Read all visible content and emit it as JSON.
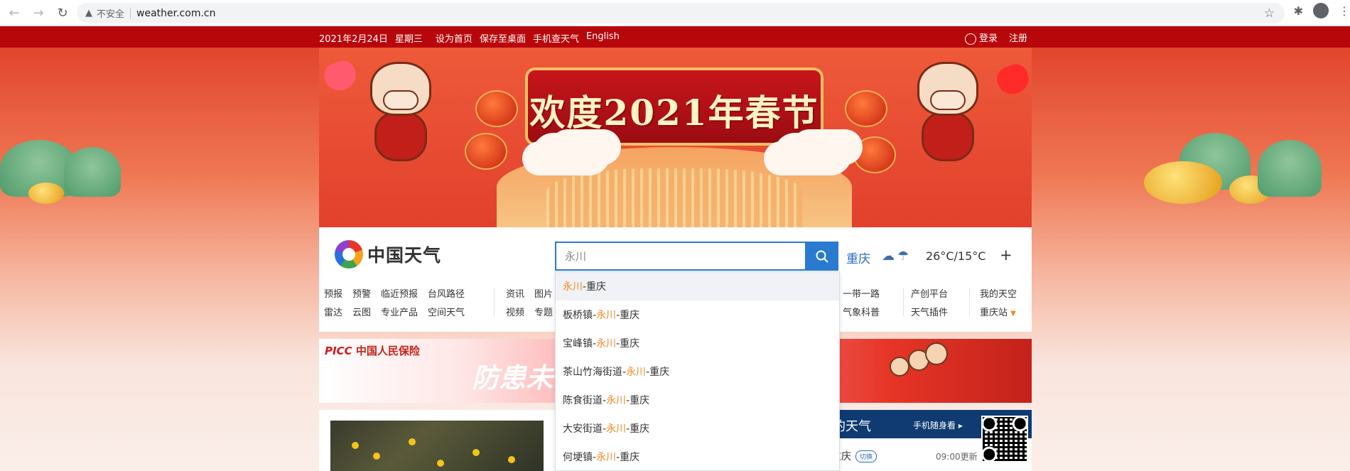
{
  "browser": {
    "security_label": "不安全",
    "url": "weather.com.cn"
  },
  "topbar": {
    "date": "2021年2月24日",
    "weekday": "星期三",
    "links": [
      "设为首页",
      "保存至桌面",
      "手机查天气",
      "English"
    ],
    "login": "登录",
    "register": "注册"
  },
  "banner": {
    "title": "欢度2021年春节"
  },
  "header": {
    "logo_text": "中国天气",
    "search_value": "永川",
    "city": "重庆",
    "temperature": "26°C/15°C",
    "add_label": "+"
  },
  "nav": {
    "group1_row1": [
      "预报",
      "预警",
      "临近预报",
      "台风路径"
    ],
    "group1_row2": [
      "雷达",
      "云图",
      "专业产品",
      "空间天气"
    ],
    "group2_row1": [
      "资讯",
      "图片"
    ],
    "group2_row2": [
      "视频",
      "专题"
    ],
    "group3_row1": [
      "一带一路"
    ],
    "group3_row2": [
      "气象科普"
    ],
    "group4_row1": [
      "产创平台"
    ],
    "group4_row2": [
      "天气插件"
    ],
    "group5_row1": [
      "我的天空"
    ],
    "group5_row2": [
      "重庆站"
    ]
  },
  "ad": {
    "brand_picc": "PICC",
    "brand_name": "中国人民保险",
    "slogan": "防患未"
  },
  "weather_panel": {
    "title": "的天气",
    "mobile_label": "手机随身看",
    "city": "重庆",
    "switch_label": "切换",
    "time": "09:00更新"
  },
  "dropdown": {
    "items": [
      {
        "prefix": "",
        "match": "永川",
        "suffix": "-重庆"
      },
      {
        "prefix": "板桥镇-",
        "match": "永川",
        "suffix": "-重庆"
      },
      {
        "prefix": "宝峰镇-",
        "match": "永川",
        "suffix": "-重庆"
      },
      {
        "prefix": "茶山竹海街道-",
        "match": "永川",
        "suffix": "-重庆"
      },
      {
        "prefix": "陈食街道-",
        "match": "永川",
        "suffix": "-重庆"
      },
      {
        "prefix": "大安街道-",
        "match": "永川",
        "suffix": "-重庆"
      },
      {
        "prefix": "何埂镇-",
        "match": "永川",
        "suffix": "-重庆"
      }
    ]
  },
  "colors": {
    "topbar_red": "#b8070b",
    "accent_blue": "#2a7ad0",
    "match_orange": "#f08a24",
    "panel_navy": "#0f3b72"
  }
}
